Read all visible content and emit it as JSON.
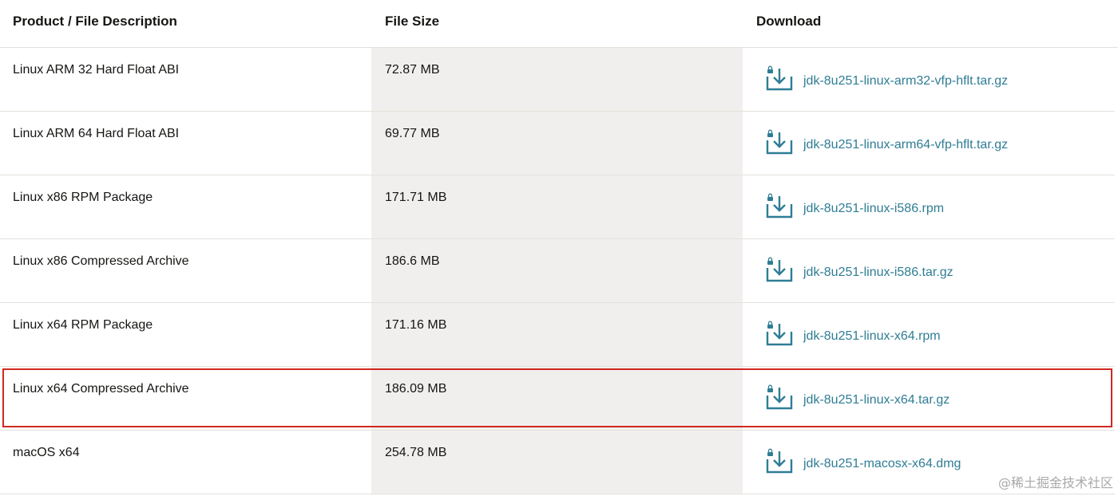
{
  "header": {
    "col_description": "Product / File Description",
    "col_size": "File Size",
    "col_download": "Download"
  },
  "rows": [
    {
      "description": "Linux ARM 32 Hard Float ABI",
      "size": "72.87 MB",
      "file": "jdk-8u251-linux-arm32-vfp-hflt.tar.gz"
    },
    {
      "description": "Linux ARM 64 Hard Float ABI",
      "size": "69.77 MB",
      "file": "jdk-8u251-linux-arm64-vfp-hflt.tar.gz"
    },
    {
      "description": "Linux x86 RPM Package",
      "size": "171.71 MB",
      "file": "jdk-8u251-linux-i586.rpm"
    },
    {
      "description": "Linux x86 Compressed Archive",
      "size": "186.6 MB",
      "file": "jdk-8u251-linux-i586.tar.gz"
    },
    {
      "description": "Linux x64 RPM Package",
      "size": "171.16 MB",
      "file": "jdk-8u251-linux-x64.rpm"
    },
    {
      "description": "Linux x64 Compressed Archive",
      "size": "186.09 MB",
      "file": "jdk-8u251-linux-x64.tar.gz"
    },
    {
      "description": "macOS x64",
      "size": "254.78 MB",
      "file": "jdk-8u251-macosx-x64.dmg"
    }
  ],
  "icons": {
    "download": "lock-download-icon"
  },
  "colors": {
    "link": "#2f7d95",
    "highlight": "#d0281f",
    "size_column_bg": "#f1efed"
  },
  "watermark": "@稀土掘金技术社区"
}
